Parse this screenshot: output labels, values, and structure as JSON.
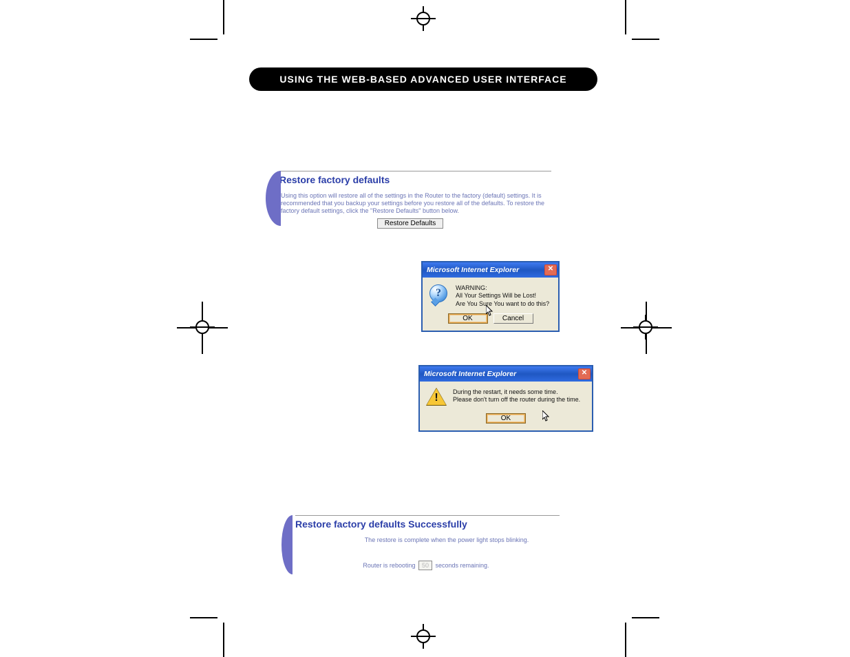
{
  "header": {
    "title": "USING THE WEB-BASED ADVANCED USER INTERFACE"
  },
  "panel_restore": {
    "title": "Restore factory defaults",
    "body": "Using this option will restore all of the settings in the Router to the factory (default) settings. It is recommended that you backup your settings before you restore all of the defaults. To restore the factory default settings, click the \"Restore Defaults\" button below.",
    "button_label": "Restore Defaults"
  },
  "dialog_confirm": {
    "title": "Microsoft Internet Explorer",
    "close_glyph": "✕",
    "message_line1": "WARNING:",
    "message_line2": "All Your Settings Will be Lost!",
    "message_line3": "Are You Sure You want to do this?",
    "ok_label": "OK",
    "cancel_label": "Cancel",
    "icon_glyph": "?"
  },
  "dialog_restart": {
    "title": "Microsoft Internet Explorer",
    "close_glyph": "✕",
    "message_line1": "During the restart, it needs some time.",
    "message_line2": "Please don't turn off the router during the time.",
    "ok_label": "OK",
    "icon_glyph": "!"
  },
  "panel_success": {
    "title": "Restore factory defaults Successfully",
    "body": "The restore is complete when the power light stops blinking.",
    "reboot_prefix": "Router is rebooting",
    "reboot_seconds": "50",
    "reboot_suffix": "seconds remaining."
  }
}
